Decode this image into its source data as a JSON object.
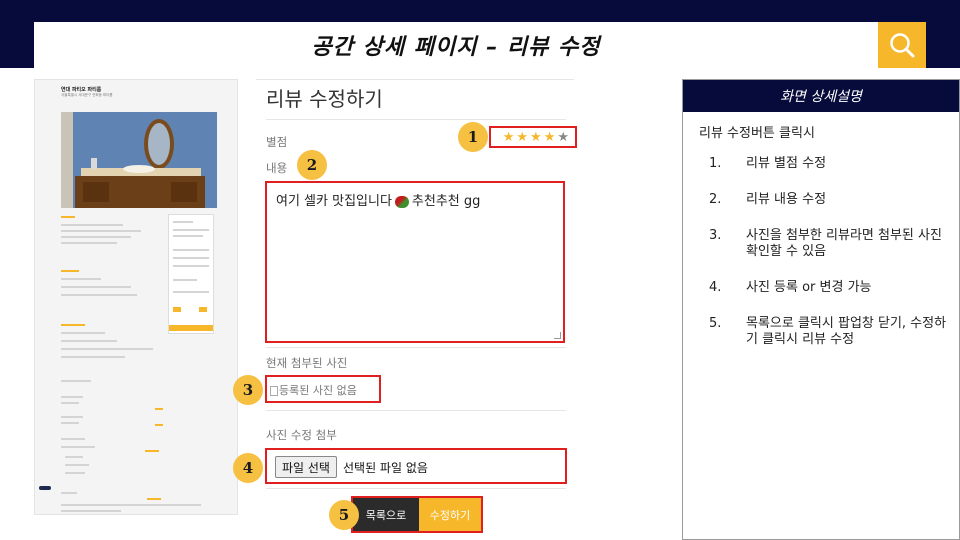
{
  "header": {
    "title": "공간 상세 페이지 – 리뷰 수정",
    "search_icon": "search-icon",
    "colors": {
      "navy": "#060b3b",
      "accent": "#f6b82a",
      "highlight": "#e02020"
    }
  },
  "thumbnail": {
    "title": "연대 파티오 파티룸",
    "subtitle": "서울특별시 서대문구 연희동 파티룸"
  },
  "form": {
    "heading": "리뷰 수정하기",
    "rating_label": "별점",
    "rating": 4,
    "rating_max": 5,
    "content_label": "내용",
    "content_value_before": "여기 셀카 맛집입니다",
    "content_value_after": "추천추천 gg",
    "current_photo_label": "현재 첨부된 사진",
    "no_photo_text": "등록된 사진 없음",
    "attach_label": "사진 수정 첨부",
    "file_button": "파일 선택",
    "file_status": "선택된 파일 없음",
    "list_button": "목록으로",
    "submit_button": "수정하기"
  },
  "badges": [
    "1",
    "2",
    "3",
    "4",
    "5"
  ],
  "panel": {
    "title": "화면 상세설명",
    "intro": "리뷰 수정버튼 클릭시",
    "items": [
      {
        "num": "1.",
        "text": "리뷰 별점 수정"
      },
      {
        "num": "2.",
        "text": "리뷰 내용 수정"
      },
      {
        "num": "3.",
        "text": "사진을 첨부한 리뷰라면 첨부된 사진 확인할 수 있음"
      },
      {
        "num": "4.",
        "text": "사진 등록 or 변경 가능"
      },
      {
        "num": "5.",
        "text": "목록으로 클릭시 팝업창 닫기, 수정하기 클릭시 리뷰 수정"
      }
    ]
  }
}
